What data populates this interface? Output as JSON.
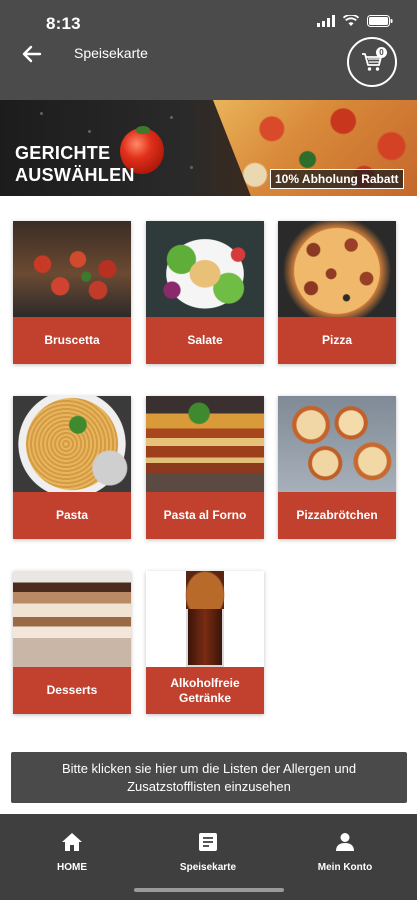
{
  "status_bar": {
    "time": "8:13"
  },
  "header": {
    "title": "Speisekarte",
    "cart_count": "0"
  },
  "banner": {
    "line1": "GERICHTE",
    "line2": "AUSWÄHLEN",
    "tag": "10% Abholung Rabatt"
  },
  "categories": [
    {
      "label": "Bruscetta"
    },
    {
      "label": "Salate"
    },
    {
      "label": "Pizza"
    },
    {
      "label": "Pasta"
    },
    {
      "label": "Pasta al Forno"
    },
    {
      "label": "Pizzabrötchen"
    },
    {
      "label": "Desserts"
    },
    {
      "label": "Alkoholfreie Getränke"
    }
  ],
  "info": {
    "text": "Bitte klicken sie hier um die Listen der Allergen und Zusatzstofflisten einzusehen"
  },
  "bottom_nav": [
    {
      "label": "HOME",
      "icon": "home-icon"
    },
    {
      "label": "Speisekarte",
      "icon": "menu-list-icon"
    },
    {
      "label": "Mein Konto",
      "icon": "user-icon"
    }
  ],
  "colors": {
    "header": "#4b4b4b",
    "accent": "#c2412e",
    "nav": "#3f3f3f"
  }
}
